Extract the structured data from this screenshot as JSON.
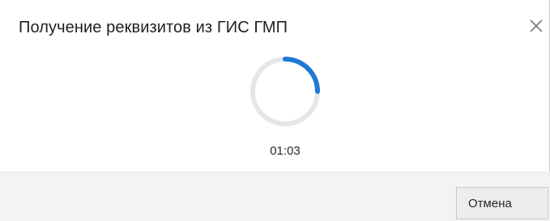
{
  "dialog": {
    "title": "Получение реквизитов из ГИС ГМП",
    "close_icon": "close-icon"
  },
  "progress": {
    "timer": "01:03",
    "spinner_icon": "loading-spinner-icon",
    "spinner_color": "#1e78d6",
    "track_color": "#e4e6ea"
  },
  "footer": {
    "cancel_label": "Отмена"
  }
}
